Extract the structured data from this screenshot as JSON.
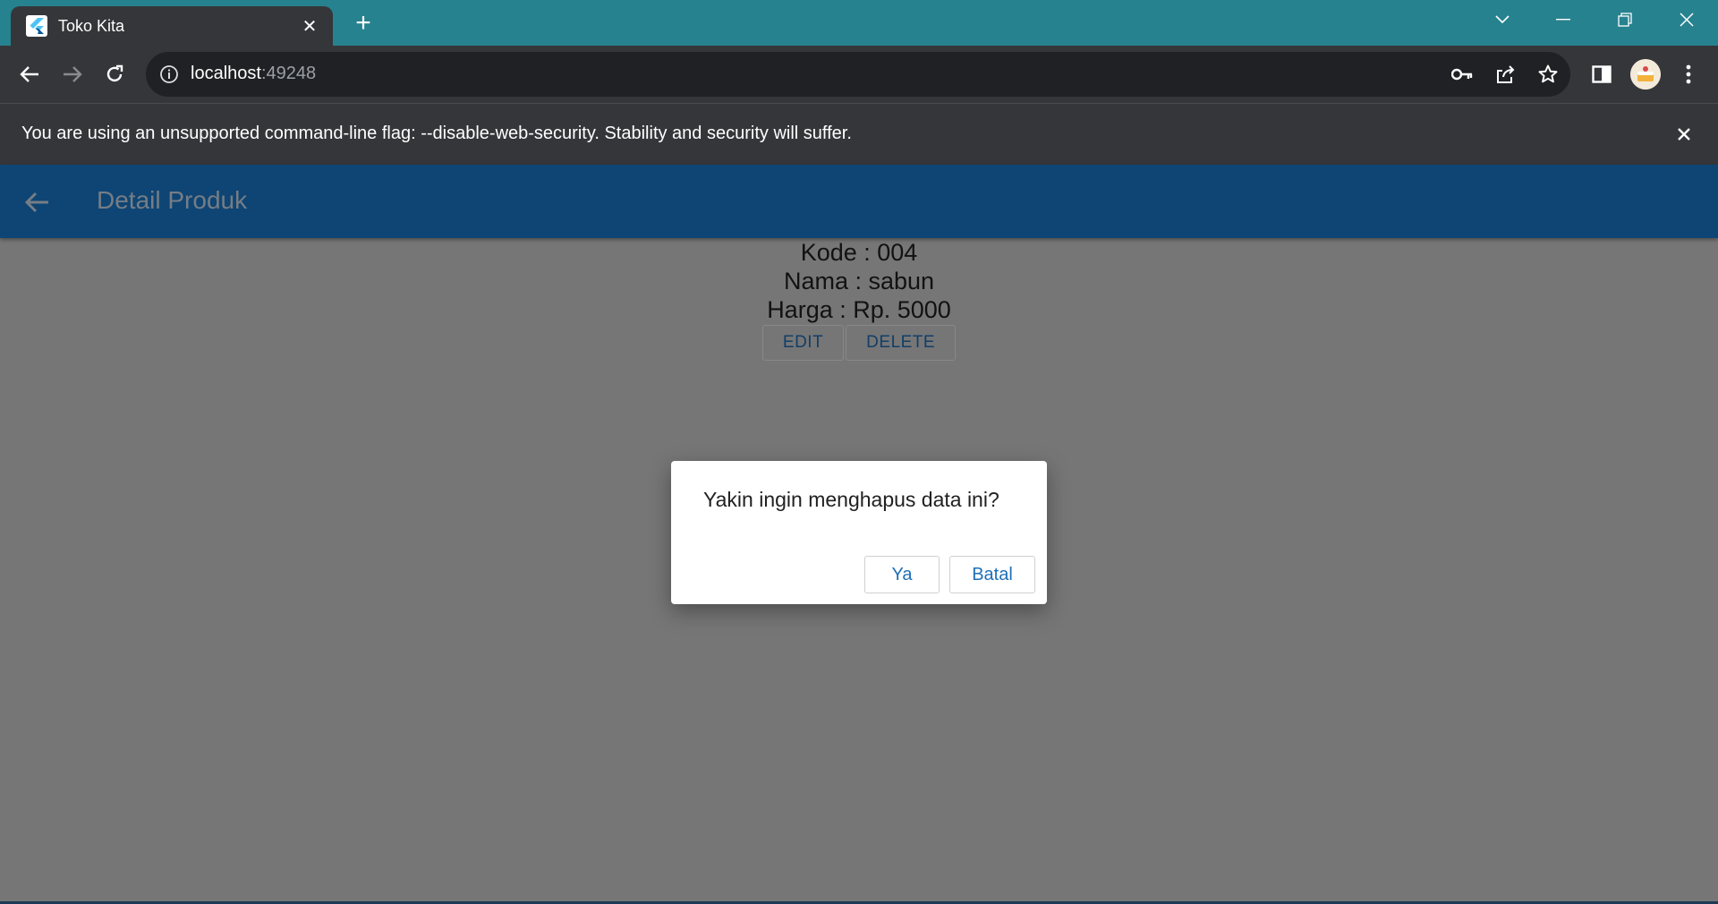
{
  "browser": {
    "tab": {
      "title": "Toko Kita"
    },
    "address": {
      "host": "localhost",
      "port": ":49248"
    },
    "infobar": {
      "message": "You are using an unsupported command-line flag: --disable-web-security. Stability and security will suffer."
    },
    "icons": [
      "flutter-favicon",
      "close-icon",
      "plus-icon",
      "chevron-down-icon",
      "minimize-icon",
      "restore-icon",
      "close-window-icon",
      "back-icon",
      "forward-icon",
      "reload-icon",
      "info-icon",
      "key-icon",
      "share-icon",
      "star-icon",
      "sidebar-icon",
      "avatar",
      "kebab-menu-icon"
    ]
  },
  "app": {
    "title": "Detail Produk",
    "product": {
      "kode": "Kode : 004",
      "nama": "Nama : sabun",
      "harga": "Harga : Rp. 5000"
    },
    "buttons": {
      "edit": "EDIT",
      "delete": "DELETE"
    }
  },
  "dialog": {
    "message": "Yakin ingin menghapus data ini?",
    "confirm": "Ya",
    "cancel": "Batal"
  },
  "colors": {
    "tabstrip": "#27828f",
    "chrome": "#35363a",
    "appbar": "#0e4574",
    "page_overlay": "#767676",
    "dialog_button_text": "#1e6fb8"
  }
}
